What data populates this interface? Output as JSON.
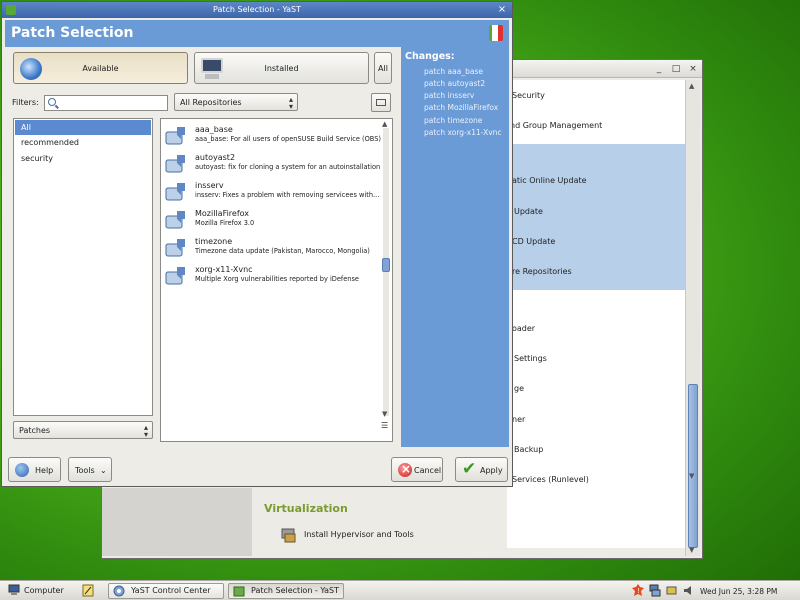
{
  "background_window": {
    "items": [
      "Security",
      "nd Group Management",
      "atic Online Update",
      "Update",
      "CD Update",
      "re Repositories",
      "oader",
      "Settings",
      "ge",
      "ner",
      "Backup",
      "Services (Runlevel)"
    ],
    "section_title": "Virtualization",
    "hypervisor_item": "Install Hypervisor and Tools"
  },
  "window": {
    "title": "Patch Selection - YaST",
    "banner_title": "Patch Selection"
  },
  "view_buttons": {
    "available": "Available",
    "installed": "Installed",
    "all": "All"
  },
  "filters": {
    "label": "Filters:",
    "search_value": "",
    "repositories_selected": "All Repositories",
    "list": [
      "All",
      "recommended",
      "security"
    ],
    "selected_index": 0,
    "bottom_combo": "Patches"
  },
  "patches": [
    {
      "name": "aaa_base",
      "desc": "aaa_base: For all users of openSUSE Build Service (OBS)"
    },
    {
      "name": "autoyast2",
      "desc": "autoyast: fix for cloning a system for an autoinstallation"
    },
    {
      "name": "insserv",
      "desc": "insserv: Fixes a problem with removing servicees with..."
    },
    {
      "name": "MozillaFirefox",
      "desc": "Mozilla Firefox 3.0"
    },
    {
      "name": "timezone",
      "desc": "Timezone data update (Pakistan, Marocco, Mongolia)"
    },
    {
      "name": "xorg-x11-Xvnc",
      "desc": "Multiple Xorg vulnerabilities reported by iDefense"
    }
  ],
  "changes": {
    "header": "Changes:",
    "items": [
      "patch aaa_base",
      "patch autoyast2",
      "patch insserv",
      "patch MozillaFirefox",
      "patch timezone",
      "patch xorg-x11-Xvnc"
    ]
  },
  "bottom_buttons": {
    "help": "Help",
    "tools": "Tools",
    "cancel": "Cancel",
    "apply": "Apply"
  },
  "taskbar": {
    "computer": "Computer",
    "task1": "YaST Control Center",
    "task2": "Patch Selection - YaST",
    "clock": "Wed Jun 25,  3:28 PM"
  },
  "colors": {
    "accent_blue": "#6b9bd6",
    "selection_blue": "#5b8ad1",
    "desktop_green": "#4fb21c"
  }
}
